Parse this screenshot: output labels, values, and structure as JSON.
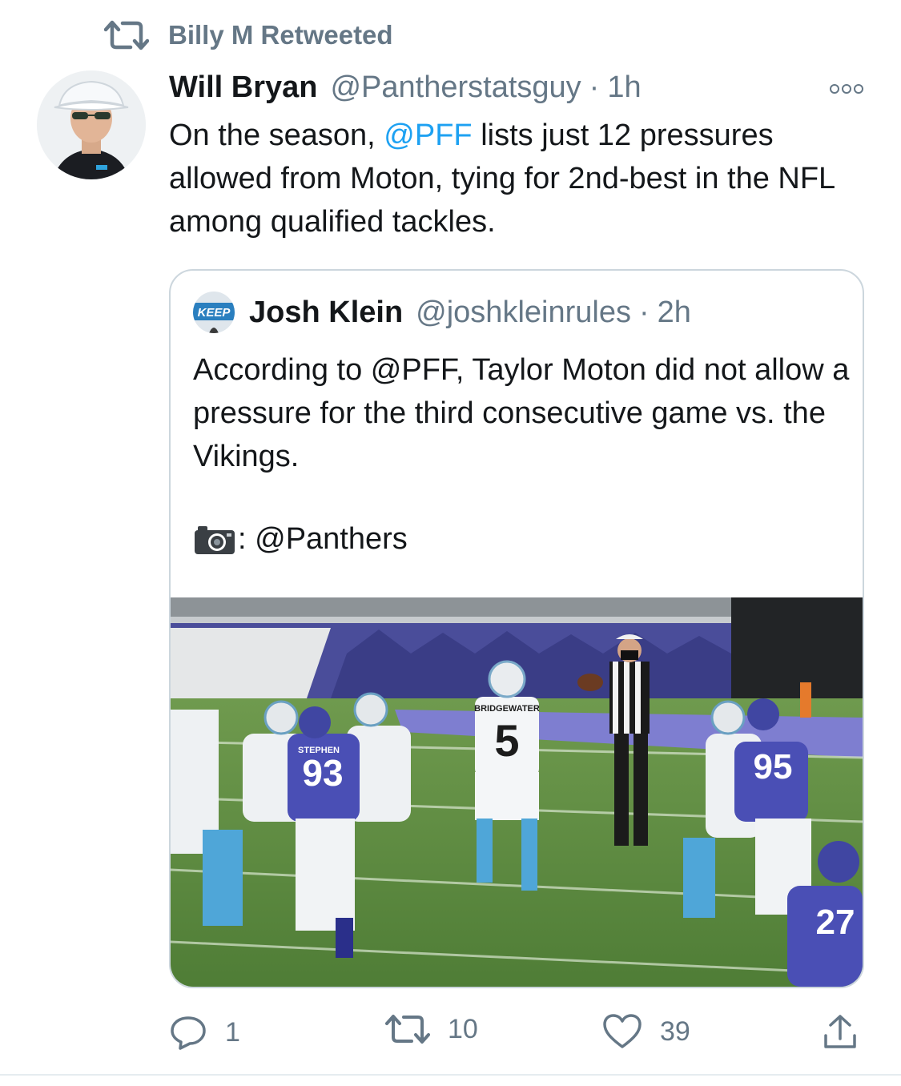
{
  "retweet_banner": {
    "icon": "retweet-icon",
    "text": "Billy M Retweeted"
  },
  "tweet": {
    "author_name": "Will Bryan",
    "handle": "@Pantherstatsguy",
    "separator": "·",
    "time": "1h",
    "text_before_mention": "On the season, ",
    "mention": "@PFF",
    "text_after_mention": " lists just 12 pressures allowed from Moton, tying for 2nd-best in the NFL among qualified tackles.",
    "more_icon": "more-options-icon"
  },
  "quoted_tweet": {
    "author_name": "Josh Klein",
    "handle": "@joshkleinrules",
    "separator": "·",
    "time": "2h",
    "text": "According to @PFF, Taylor Moton did not allow a pressure for the third consecutive game vs. the Vikings.",
    "camera_icon": "camera-icon",
    "credit_text": ": @Panthers",
    "avatar_text": "KEEP",
    "photo": {
      "description_icon": "football-photo",
      "jersey_qb_name": "BRIDGEWATER",
      "jersey_qb_number": "5",
      "jersey_left_name": "STEPHEN",
      "jersey_left_number": "93",
      "jersey_right_number": "95",
      "jersey_corner_number": "27"
    }
  },
  "actions": {
    "reply": {
      "icon": "reply-icon",
      "count": "1"
    },
    "retweet": {
      "icon": "retweet-icon",
      "count": "10"
    },
    "like": {
      "icon": "heart-icon",
      "count": "39"
    },
    "share": {
      "icon": "share-icon"
    }
  },
  "colors": {
    "link": "#1da1f2",
    "secondary": "#657786",
    "border": "#ccd6dd"
  }
}
